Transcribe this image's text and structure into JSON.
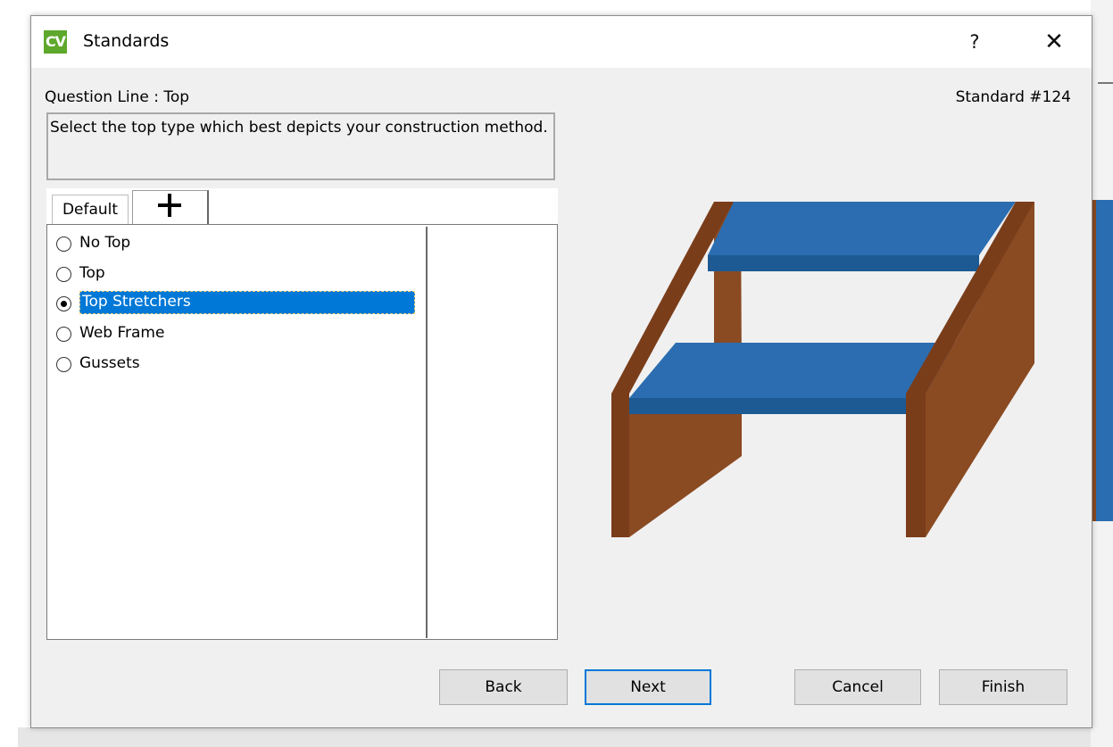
{
  "dialog": {
    "app_icon": "CV",
    "title": "Standards",
    "help": "?",
    "close": "✕"
  },
  "question": {
    "label": "Question Line : Top",
    "standard": "Standard #124",
    "description": "Select the top type which best depicts your construction method."
  },
  "tabs": [
    {
      "label": "Default"
    },
    {
      "label": "+",
      "icon": "plus-icon"
    }
  ],
  "options": [
    {
      "label": "No Top",
      "checked": false
    },
    {
      "label": "Top",
      "checked": false
    },
    {
      "label": "Top Stretchers",
      "checked": true
    },
    {
      "label": "Web Frame",
      "checked": false
    },
    {
      "label": "Gussets",
      "checked": false
    }
  ],
  "buttons": {
    "back": "Back",
    "next": "Next",
    "cancel": "Cancel",
    "finish": "Finish"
  },
  "colors": {
    "stretcher_top": "#2b6db0",
    "stretcher_front": "#1d5a93",
    "side_front": "#7a3d1a",
    "side_face": "#8a4a22",
    "selection": "#0078d7",
    "app_icon": "#5ea82b"
  }
}
